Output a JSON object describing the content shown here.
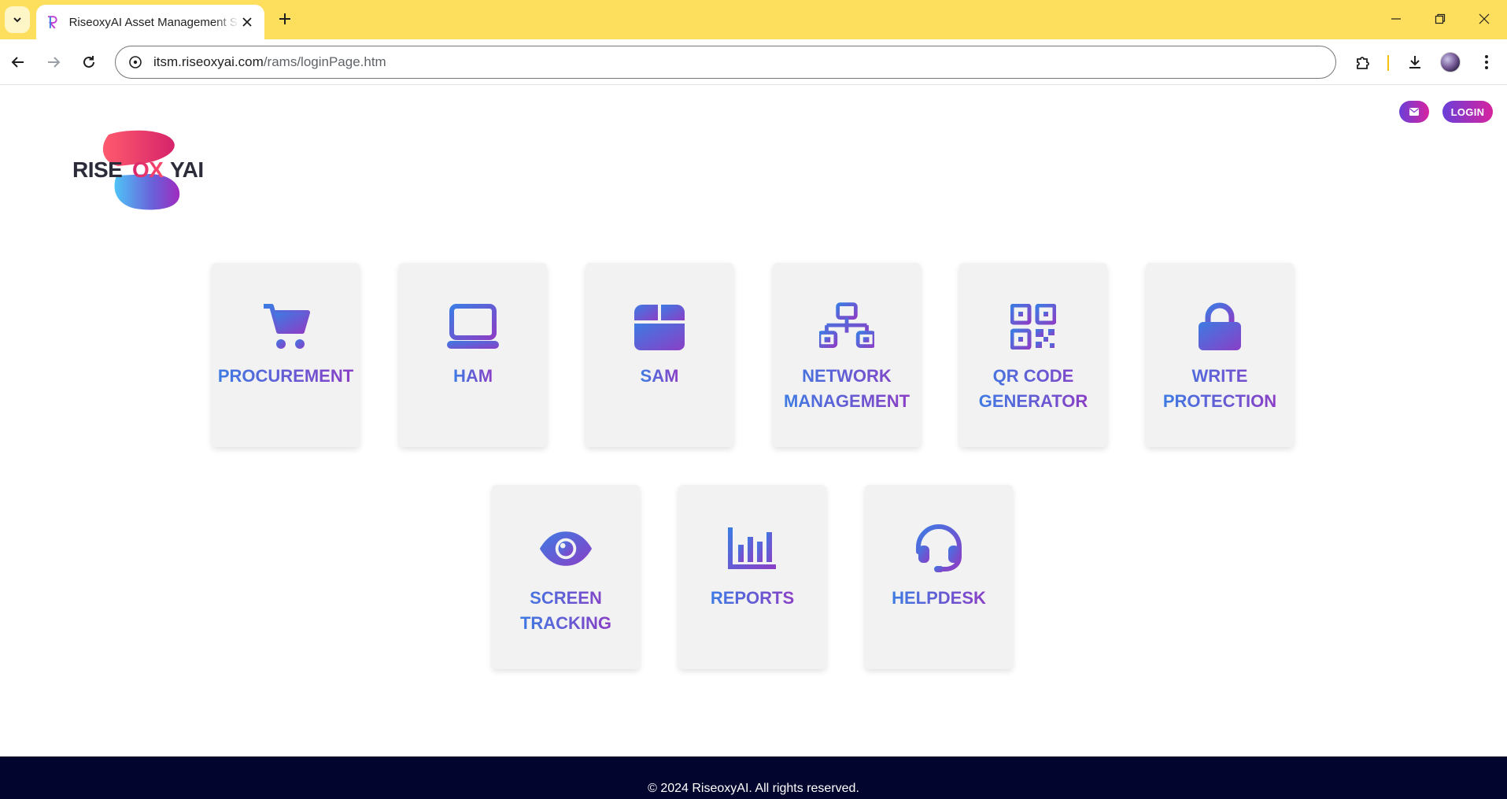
{
  "browser": {
    "tab_title": "RiseoxyAI Asset Management S",
    "url_host": "itsm.riseoxyai.com",
    "url_path": "/rams/loginPage.htm"
  },
  "header": {
    "login_label": "LOGIN",
    "logo_text": "RISEOXYAI"
  },
  "modules": [
    {
      "label": "PROCUREMENT",
      "icon": "cart-icon"
    },
    {
      "label": "HAM",
      "icon": "laptop-icon"
    },
    {
      "label": "SAM",
      "icon": "box-icon"
    },
    {
      "label": "NETWORK\nMANAGEMENT",
      "icon": "network-icon"
    },
    {
      "label": "QR CODE\nGENERATOR",
      "icon": "qr-code-icon"
    },
    {
      "label": "WRITE\nPROTECTION",
      "icon": "lock-icon"
    },
    {
      "label": "SCREEN\nTRACKING",
      "icon": "eye-icon"
    },
    {
      "label": "REPORTS",
      "icon": "bar-chart-icon"
    },
    {
      "label": "HELPDESK",
      "icon": "headset-icon"
    }
  ],
  "footer": {
    "text": "© 2024 RiseoxyAI. All rights reserved."
  },
  "colors": {
    "tabbar": "#fede5d",
    "accent_start": "#3d7be3",
    "accent_end": "#8a3fc6",
    "button_gradient_start": "#6a3fd8",
    "button_gradient_end": "#d6249f",
    "footer_bg": "#02052e"
  }
}
